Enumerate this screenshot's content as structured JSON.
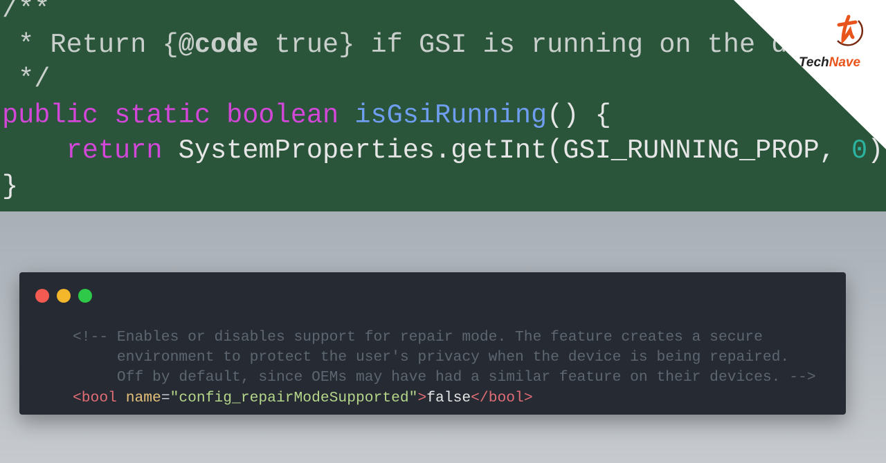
{
  "top_code": {
    "line1": "/**",
    "line2_prefix": " * Return {",
    "line2_tag": "@code",
    "line2_suffix": " true} if GSI is running on the d",
    "line3": " */",
    "kw_public": "public",
    "kw_static": "static",
    "kw_boolean": "boolean",
    "method_name": "isGsiRunning",
    "method_tail": "() {",
    "kw_return": "return",
    "call": "SystemProperties.getInt(GSI_RUNNING_PROP, ",
    "num": "0",
    "call_end": ")",
    "close": "}",
    "colors": {
      "background": "#2a553b",
      "keyword": "#d347d8",
      "function": "#6f9ef0",
      "number": "#2bb3a0"
    }
  },
  "logo": {
    "brand": "TechNave",
    "mark": "tn"
  },
  "window": {
    "controls": [
      "close",
      "minimize",
      "maximize"
    ],
    "control_colors": [
      "#f25a52",
      "#f4b72c",
      "#2ec948"
    ],
    "comment_lines": [
      "<!-- Enables or disables support for repair mode. The feature creates a secure",
      "     environment to protect the user's privacy when the device is being repaired.",
      "     Off by default, since OEMs may have had a similar feature on their devices. -->"
    ],
    "xml": {
      "open_tag": "<bool",
      "attr": "name",
      "eq": "=",
      "value": "\"config_repairModeSupported\"",
      "gt": ">",
      "text": "false",
      "close_tag": "</bool>"
    }
  }
}
